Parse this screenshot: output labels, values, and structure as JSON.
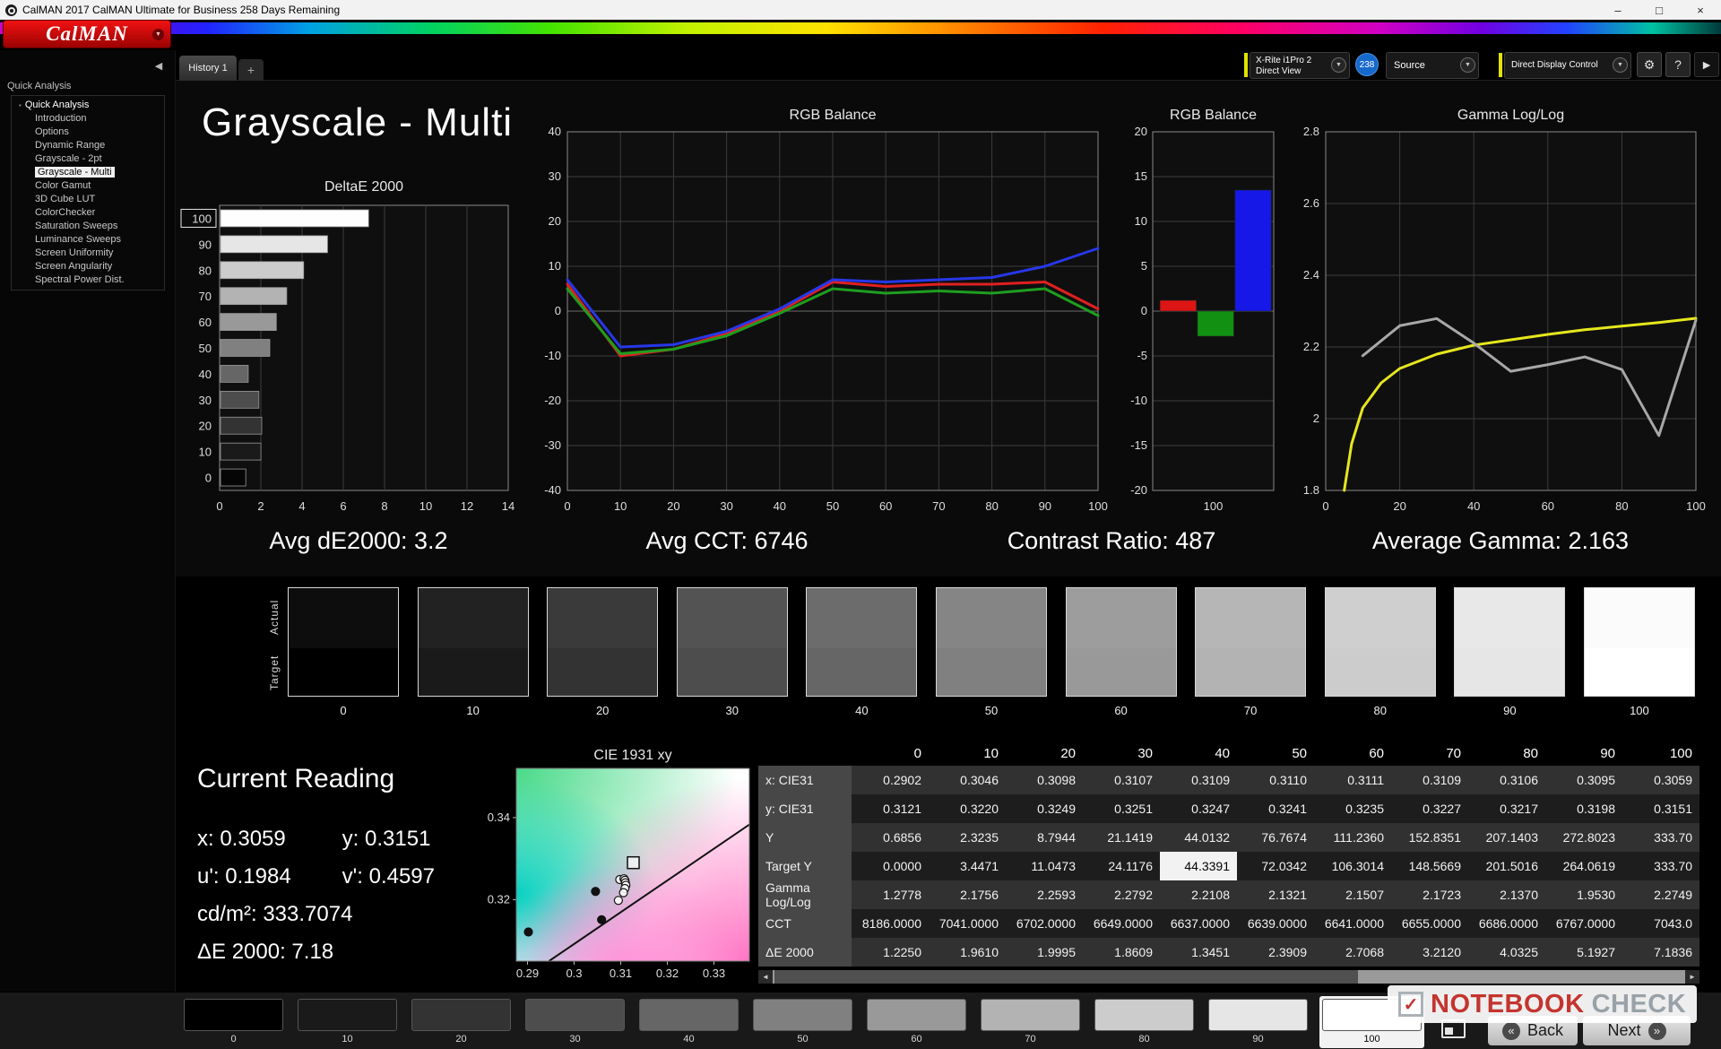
{
  "window": {
    "title": "CalMAN 2017 CalMAN Ultimate for Business 258 Days Remaining"
  },
  "icons": {
    "minimize": "–",
    "maximize": "□",
    "close": "×",
    "dropdown": "▼",
    "collapse": "◀",
    "gear": "⚙",
    "help": "?",
    "forward": "►",
    "plus": "+",
    "back_chevron": "«",
    "next_chevron": "»",
    "root_marker": "▪",
    "check": "✓",
    "scroll_left": "◄",
    "scroll_right": "►"
  },
  "logo": {
    "text": "CalMAN"
  },
  "tabs": {
    "active": "History 1"
  },
  "toolbar": {
    "meter_line1": "X-Rite i1Pro 2",
    "meter_line2": "Direct View",
    "badge": "238",
    "source": "Source",
    "display_control": "Direct Display Control"
  },
  "sidebar": {
    "header": "Quick Analysis",
    "items": [
      {
        "label": "Quick Analysis",
        "level": 0,
        "selected": false
      },
      {
        "label": "Introduction",
        "level": 1,
        "selected": false
      },
      {
        "label": "Options",
        "level": 1,
        "selected": false
      },
      {
        "label": "Dynamic Range",
        "level": 1,
        "selected": false
      },
      {
        "label": "Grayscale - 2pt",
        "level": 1,
        "selected": false
      },
      {
        "label": "Grayscale - Multi",
        "level": 1,
        "selected": true
      },
      {
        "label": "Color Gamut",
        "level": 1,
        "selected": false
      },
      {
        "label": "3D Cube LUT",
        "level": 1,
        "selected": false
      },
      {
        "label": "ColorChecker",
        "level": 1,
        "selected": false
      },
      {
        "label": "Saturation Sweeps",
        "level": 1,
        "selected": false
      },
      {
        "label": "Luminance Sweeps",
        "level": 1,
        "selected": false
      },
      {
        "label": "Screen Uniformity",
        "level": 1,
        "selected": false
      },
      {
        "label": "Screen Angularity",
        "level": 1,
        "selected": false
      },
      {
        "label": "Spectral Power Dist.",
        "level": 1,
        "selected": false
      }
    ]
  },
  "page": {
    "title": "Grayscale - Multi"
  },
  "stats": [
    "Avg dE2000: 3.2",
    "Avg CCT: 6746",
    "Contrast Ratio: 487",
    "Average Gamma: 2.163"
  ],
  "chart_data": [
    {
      "id": "deltae",
      "type": "bar",
      "orientation": "horizontal",
      "title": "DeltaE 2000",
      "categories": [
        "0",
        "10",
        "20",
        "30",
        "40",
        "50",
        "60",
        "70",
        "80",
        "90",
        "100"
      ],
      "values": [
        1.225,
        1.961,
        1.9995,
        1.8609,
        1.3451,
        2.3909,
        2.7068,
        3.212,
        4.0325,
        5.1927,
        7.1836
      ],
      "xlim": [
        0,
        14
      ],
      "xticks": [
        0,
        2,
        4,
        6,
        8,
        10,
        12,
        14
      ],
      "bar_colors": [
        "#050505",
        "#1a1a1a",
        "#333333",
        "#4d4d4d",
        "#666666",
        "#808080",
        "#999999",
        "#b3b3b3",
        "#cccccc",
        "#e6e6e6",
        "#fefefe"
      ],
      "highlighted_category": "100"
    },
    {
      "id": "rgb_line",
      "type": "line",
      "title": "RGB Balance",
      "x": [
        0,
        10,
        20,
        30,
        40,
        50,
        60,
        70,
        80,
        90,
        100
      ],
      "xticks": [
        0,
        10,
        20,
        30,
        40,
        50,
        60,
        70,
        80,
        90,
        100
      ],
      "ylim": [
        -40,
        40
      ],
      "yticks": [
        -40,
        -30,
        -20,
        -10,
        0,
        10,
        20,
        30,
        40
      ],
      "series": [
        {
          "name": "Red",
          "color": "#e02020",
          "values": [
            6,
            -10,
            -8.5,
            -5,
            0,
            6.5,
            5.5,
            6,
            6,
            6.5,
            0.5
          ]
        },
        {
          "name": "Green",
          "color": "#1e9e1e",
          "values": [
            5,
            -9.5,
            -8.5,
            -5.5,
            -0.5,
            5,
            4,
            4.5,
            4,
            5,
            -1
          ]
        },
        {
          "name": "Blue",
          "color": "#2737e8",
          "values": [
            7,
            -8,
            -7.5,
            -4.5,
            0.5,
            7,
            6.5,
            7,
            7.5,
            10,
            14
          ]
        }
      ]
    },
    {
      "id": "rgb_bar",
      "type": "bar",
      "title": "RGB Balance",
      "categories": [
        "Red",
        "Green",
        "Blue"
      ],
      "values": [
        1.2,
        -2.8,
        13.5
      ],
      "bar_colors": [
        "#dd1515",
        "#129012",
        "#1518e6"
      ],
      "ylim": [
        -20,
        20
      ],
      "yticks": [
        -20,
        -15,
        -10,
        -5,
        0,
        5,
        10,
        15,
        20
      ],
      "xlabel": "100"
    },
    {
      "id": "gamma",
      "type": "line",
      "title": "Gamma Log/Log",
      "ylim": [
        1.8,
        2.8
      ],
      "yticks": [
        1.8,
        2.0,
        2.2,
        2.4,
        2.6,
        2.8
      ],
      "ytick_labels": [
        "1.8",
        "2",
        "2.2",
        "2.4",
        "2.6",
        "2.8"
      ],
      "xticks": [
        0,
        20,
        40,
        60,
        80,
        100
      ],
      "series": [
        {
          "name": "Target",
          "color": "#e6e61e",
          "x": [
            5,
            7,
            10,
            15,
            20,
            25,
            30,
            40,
            50,
            60,
            70,
            80,
            90,
            100
          ],
          "values": [
            1.8,
            1.93,
            2.03,
            2.1,
            2.14,
            2.16,
            2.18,
            2.205,
            2.22,
            2.235,
            2.248,
            2.258,
            2.268,
            2.28
          ]
        },
        {
          "name": "Measured",
          "color": "#a8a8a8",
          "x": [
            10,
            20,
            30,
            40,
            50,
            60,
            70,
            80,
            90,
            100
          ],
          "values": [
            2.1756,
            2.2593,
            2.2792,
            2.2108,
            2.1321,
            2.1507,
            2.1723,
            2.137,
            1.953,
            2.2749
          ]
        }
      ]
    },
    {
      "id": "cie",
      "type": "scatter",
      "title": "CIE 1931 xy",
      "xlim": [
        0.2876,
        0.3376
      ],
      "ylim": [
        0.305,
        0.352
      ],
      "xticks": [
        0.29,
        0.3,
        0.31,
        0.32,
        0.33
      ],
      "xtick_labels": [
        "0.29",
        "0.3",
        "0.31",
        "0.32",
        "0.33"
      ],
      "yticks": [
        0.32,
        0.34
      ],
      "ytick_labels": [
        "0.32",
        "0.34"
      ],
      "points": [
        {
          "x": 0.2902,
          "y": 0.3121,
          "filled": true
        },
        {
          "x": 0.3046,
          "y": 0.322,
          "filled": true
        },
        {
          "x": 0.3098,
          "y": 0.3249,
          "filled": false
        },
        {
          "x": 0.3107,
          "y": 0.3251,
          "filled": false
        },
        {
          "x": 0.3109,
          "y": 0.3247,
          "filled": false
        },
        {
          "x": 0.311,
          "y": 0.3241,
          "filled": false
        },
        {
          "x": 0.3111,
          "y": 0.3235,
          "filled": false
        },
        {
          "x": 0.3109,
          "y": 0.3227,
          "filled": false
        },
        {
          "x": 0.3106,
          "y": 0.3217,
          "filled": false
        },
        {
          "x": 0.3095,
          "y": 0.3198,
          "filled": false
        },
        {
          "x": 0.3059,
          "y": 0.3151,
          "filled": true
        }
      ],
      "target_point": {
        "x": 0.3127,
        "y": 0.329
      },
      "locus_line": [
        [
          0.2946,
          0.305
        ],
        [
          0.3376,
          0.3383
        ]
      ]
    }
  ],
  "grayscale_swatches": {
    "row_labels": [
      "Actual",
      "Target"
    ],
    "levels": [
      "0",
      "10",
      "20",
      "30",
      "40",
      "50",
      "60",
      "70",
      "80",
      "90",
      "100"
    ],
    "actual_colors": [
      "#0d0d0d",
      "#222222",
      "#3a3a3a",
      "#535353",
      "#6c6c6c",
      "#858585",
      "#9d9d9d",
      "#b6b6b6",
      "#cfcfcf",
      "#e8e8e8",
      "#fbfbfb"
    ],
    "target_colors": [
      "#000000",
      "#1a1a1a",
      "#333333",
      "#4d4d4d",
      "#666666",
      "#808080",
      "#999999",
      "#b3b3b3",
      "#cccccc",
      "#e6e6e6",
      "#ffffff"
    ]
  },
  "current_reading": {
    "title": "Current Reading",
    "items": [
      "x: 0.3059",
      "y: 0.3151",
      "u': 0.1984",
      "v': 0.4597",
      "cd/m²: 333.7074",
      "ΔE 2000: 7.18"
    ]
  },
  "table": {
    "columns": [
      "0",
      "10",
      "20",
      "30",
      "40",
      "50",
      "60",
      "70",
      "80",
      "90",
      "100"
    ],
    "rows": [
      {
        "label": "x: CIE31",
        "values": [
          "0.2902",
          "0.3046",
          "0.3098",
          "0.3107",
          "0.3109",
          "0.3110",
          "0.3111",
          "0.3109",
          "0.3106",
          "0.3095",
          "0.3059"
        ]
      },
      {
        "label": "y: CIE31",
        "values": [
          "0.3121",
          "0.3220",
          "0.3249",
          "0.3251",
          "0.3247",
          "0.3241",
          "0.3235",
          "0.3227",
          "0.3217",
          "0.3198",
          "0.3151"
        ]
      },
      {
        "label": "Y",
        "values": [
          "0.6856",
          "2.3235",
          "8.7944",
          "21.1419",
          "44.0132",
          "76.7674",
          "111.2360",
          "152.8351",
          "207.1403",
          "272.8023",
          "333.70"
        ]
      },
      {
        "label": "Target Y",
        "values": [
          "0.0000",
          "3.4471",
          "11.0473",
          "24.1176",
          "44.3391",
          "72.0342",
          "106.3014",
          "148.5669",
          "201.5016",
          "264.0619",
          "333.70"
        ]
      },
      {
        "label": "Gamma Log/Log",
        "values": [
          "1.2778",
          "2.1756",
          "2.2593",
          "2.2792",
          "2.2108",
          "2.1321",
          "2.1507",
          "2.1723",
          "2.1370",
          "1.9530",
          "2.2749"
        ]
      },
      {
        "label": "CCT",
        "values": [
          "8186.0000",
          "7041.0000",
          "6702.0000",
          "6649.0000",
          "6637.0000",
          "6639.0000",
          "6641.0000",
          "6655.0000",
          "6686.0000",
          "6767.0000",
          "7043.0"
        ]
      },
      {
        "label": "ΔE 2000",
        "values": [
          "1.2250",
          "1.9610",
          "1.9995",
          "1.8609",
          "1.3451",
          "2.3909",
          "2.7068",
          "3.2120",
          "4.0325",
          "5.1927",
          "7.1836"
        ]
      }
    ],
    "highlight": {
      "row": 3,
      "col": 4
    }
  },
  "bottom_bar": {
    "levels": [
      "0",
      "10",
      "20",
      "30",
      "40",
      "50",
      "60",
      "70",
      "80",
      "90",
      "100"
    ],
    "colors": [
      "#000000",
      "#1a1a1a",
      "#333333",
      "#4d4d4d",
      "#666666",
      "#808080",
      "#999999",
      "#b3b3b3",
      "#cccccc",
      "#e6e6e6",
      "#ffffff"
    ],
    "selected": "100",
    "back_label": "Back",
    "next_label": "Next"
  },
  "watermark": {
    "part1": "NOTEBOOK",
    "part2": "CHECK"
  }
}
